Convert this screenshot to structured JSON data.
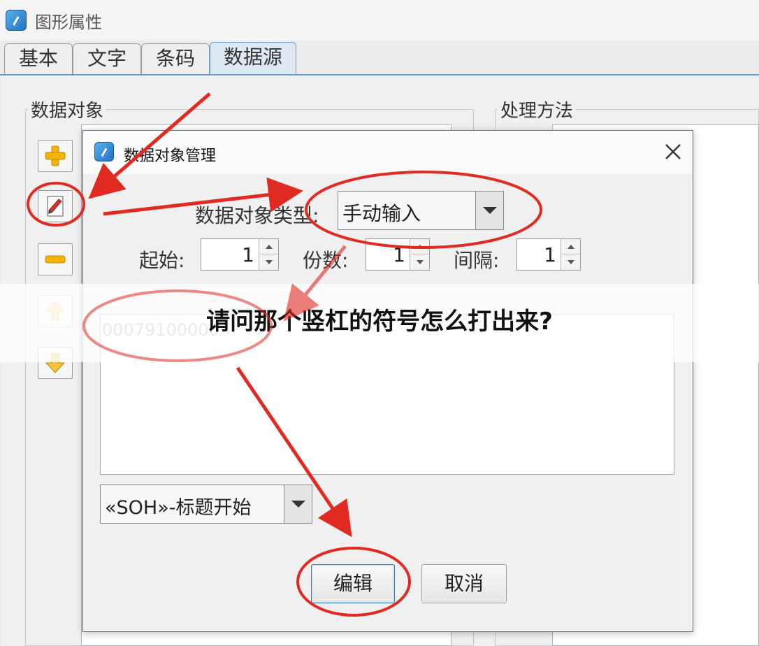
{
  "window": {
    "title": "图形属性"
  },
  "tabs": [
    {
      "label": "基本"
    },
    {
      "label": "文字"
    },
    {
      "label": "条码"
    },
    {
      "label": "数据源",
      "active": true
    }
  ],
  "groups": {
    "data_object": "数据对象",
    "processing": "处理方法"
  },
  "side_buttons": [
    "plus-icon",
    "edit-icon",
    "minus-icon",
    "arrow-up-icon",
    "arrow-down-icon"
  ],
  "dialog": {
    "title": "数据对象管理",
    "type_label": "数据对象类型:",
    "type_value": "手动输入",
    "start_label": "起始:",
    "start_value": "1",
    "count_label": "份数:",
    "count_value": "1",
    "interval_label": "间隔:",
    "interval_value": "1",
    "text_content": "00079100000",
    "control_char_value": "«SOH»-标题开始",
    "edit_button": "编辑",
    "cancel_button": "取消"
  },
  "overlay": {
    "question": "请问那个竖杠的符号怎么打出来?"
  },
  "colors": {
    "accent": "#6e9cc9",
    "annotation_red": "#e02a22"
  }
}
